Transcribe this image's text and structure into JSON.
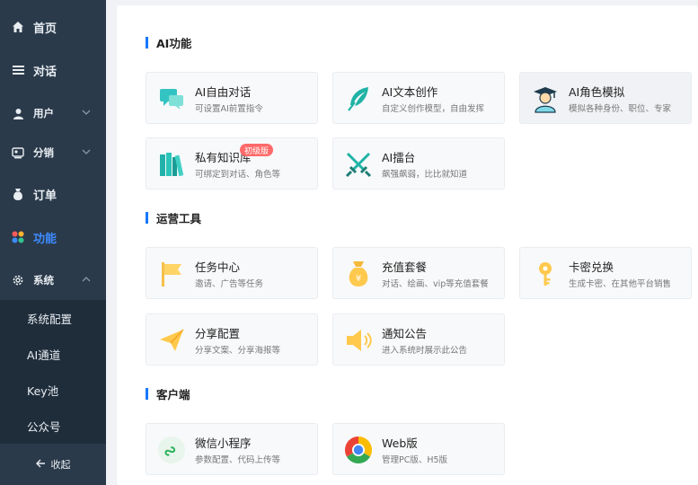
{
  "sidebar": {
    "items": [
      {
        "label": "首页",
        "icon": "home-icon"
      },
      {
        "label": "对话",
        "icon": "list-icon"
      },
      {
        "label": "用户",
        "icon": "user-icon"
      },
      {
        "label": "分销",
        "icon": "share-icon"
      },
      {
        "label": "订单",
        "icon": "money-bag-icon"
      },
      {
        "label": "功能",
        "icon": "apps-icon",
        "active": true
      },
      {
        "label": "系统",
        "icon": "gear-icon"
      }
    ],
    "submenu": [
      "系统配置",
      "AI通道",
      "Key池",
      "公众号"
    ],
    "collapse_label": "收起",
    "active_color": "#3d8bff"
  },
  "sections": [
    {
      "title": "AI功能",
      "cards": [
        {
          "title": "AI自由对话",
          "subtitle": "可设置AI前置指令",
          "icon": "chat-bubbles-icon"
        },
        {
          "title": "AI文本创作",
          "subtitle": "自定义创作模型，自由发挥",
          "icon": "feather-icon"
        },
        {
          "title": "AI角色模拟",
          "subtitle": "模拟各种身份、职位、专家",
          "icon": "graduate-icon"
        },
        {
          "title": "私有知识库",
          "subtitle": "可绑定到对话、角色等",
          "icon": "books-icon",
          "badge": "初级版"
        },
        {
          "title": "AI擂台",
          "subtitle": "飙强飙弱，比比就知道",
          "icon": "crossed-swords-icon"
        }
      ]
    },
    {
      "title": "运营工具",
      "cards": [
        {
          "title": "任务中心",
          "subtitle": "邀请、广告等任务",
          "icon": "flag-icon"
        },
        {
          "title": "充值套餐",
          "subtitle": "对话、绘画、vip等充值套餐",
          "icon": "money-bag-icon"
        },
        {
          "title": "卡密兑换",
          "subtitle": "生成卡密、在其他平台销售",
          "icon": "key-icon"
        },
        {
          "title": "分享配置",
          "subtitle": "分享文案、分享海报等",
          "icon": "paper-plane-icon"
        },
        {
          "title": "通知公告",
          "subtitle": "进入系统时展示此公告",
          "icon": "speaker-icon"
        }
      ]
    },
    {
      "title": "客户端",
      "cards": [
        {
          "title": "微信小程序",
          "subtitle": "参数配置、代码上传等",
          "icon": "mini-program-icon"
        },
        {
          "title": "Web版",
          "subtitle": "管理PC版、H5版",
          "icon": "chrome-icon"
        }
      ]
    }
  ]
}
